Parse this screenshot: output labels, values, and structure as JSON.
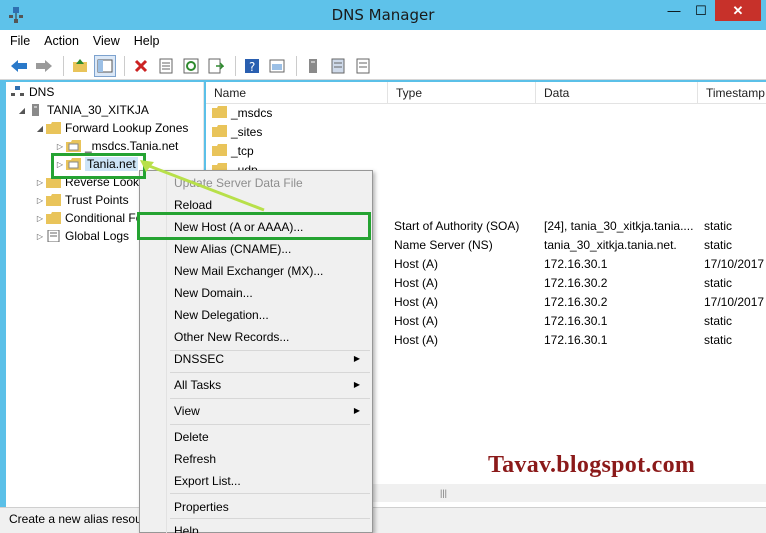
{
  "window": {
    "title": "DNS Manager",
    "min": "—",
    "max": "☐",
    "close": "✕"
  },
  "menubar": [
    "File",
    "Action",
    "View",
    "Help"
  ],
  "tree": {
    "root": "DNS",
    "server": "TANIA_30_XITKJA",
    "forward": "Forward Lookup Zones",
    "msdcs": "_msdcs.Tania.net",
    "zone": "Tania.net",
    "reverse": "Reverse Lookup Zones",
    "trust": "Trust Points",
    "conditional": "Conditional Forwarders",
    "global": "Global Logs"
  },
  "list": {
    "headers": [
      "Name",
      "Type",
      "Data",
      "Timestamp"
    ],
    "folders": [
      "_msdcs",
      "_sites",
      "_tcp",
      "_udp"
    ],
    "records": [
      {
        "type": "Start of Authority (SOA)",
        "data": "[24], tania_30_xitkja.tania....",
        "ts": "static"
      },
      {
        "type": "Name Server (NS)",
        "data": "tania_30_xitkja.tania.net.",
        "ts": "static"
      },
      {
        "type": "Host (A)",
        "data": "172.16.30.1",
        "ts": "17/10/2017"
      },
      {
        "type": "Host (A)",
        "data": "172.16.30.2",
        "ts": "static"
      },
      {
        "type": "Host (A)",
        "data": "172.16.30.2",
        "ts": "17/10/2017"
      },
      {
        "type": "Host (A)",
        "data": "172.16.30.1",
        "ts": "static"
      },
      {
        "type": "Host (A)",
        "data": "172.16.30.1",
        "ts": "static"
      }
    ]
  },
  "context_menu": {
    "update": "Update Server Data File",
    "reload": "Reload",
    "new_host": "New Host (A or AAAA)...",
    "new_alias": "New Alias (CNAME)...",
    "new_mx": "New Mail Exchanger (MX)...",
    "new_domain": "New Domain...",
    "new_delegation": "New Delegation...",
    "other": "Other New Records...",
    "dnssec": "DNSSEC",
    "all_tasks": "All Tasks",
    "view": "View",
    "delete": "Delete",
    "refresh": "Refresh",
    "export": "Export List...",
    "properties": "Properties",
    "help": "Help"
  },
  "statusbar": "Create a new alias resource record.",
  "watermark": "Tavav.blogspot.com",
  "colors": {
    "titlebar": "#5ec2ea",
    "highlight": "#25a332",
    "pointer": "#b8e04a",
    "watermark": "#8b1a1a"
  }
}
